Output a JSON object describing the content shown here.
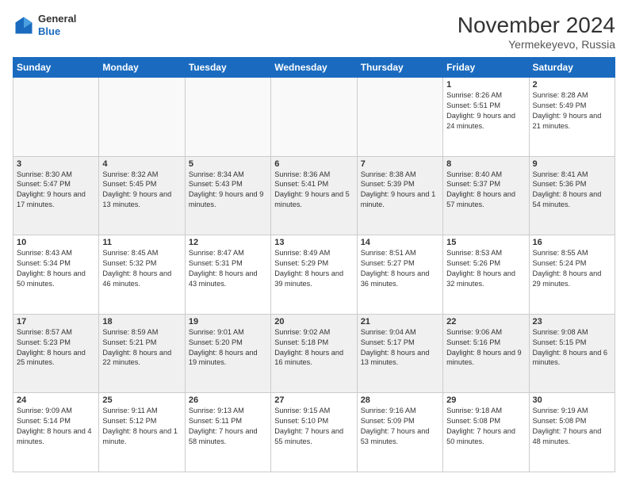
{
  "header": {
    "logo_general": "General",
    "logo_blue": "Blue",
    "month_title": "November 2024",
    "location": "Yermekeyevo, Russia"
  },
  "days_of_week": [
    "Sunday",
    "Monday",
    "Tuesday",
    "Wednesday",
    "Thursday",
    "Friday",
    "Saturday"
  ],
  "weeks": [
    {
      "days": [
        {
          "num": "",
          "sunrise": "",
          "sunset": "",
          "daylight": "",
          "empty": true
        },
        {
          "num": "",
          "sunrise": "",
          "sunset": "",
          "daylight": "",
          "empty": true
        },
        {
          "num": "",
          "sunrise": "",
          "sunset": "",
          "daylight": "",
          "empty": true
        },
        {
          "num": "",
          "sunrise": "",
          "sunset": "",
          "daylight": "",
          "empty": true
        },
        {
          "num": "",
          "sunrise": "",
          "sunset": "",
          "daylight": "",
          "empty": true
        },
        {
          "num": "1",
          "sunrise": "Sunrise: 8:26 AM",
          "sunset": "Sunset: 5:51 PM",
          "daylight": "Daylight: 9 hours and 24 minutes."
        },
        {
          "num": "2",
          "sunrise": "Sunrise: 8:28 AM",
          "sunset": "Sunset: 5:49 PM",
          "daylight": "Daylight: 9 hours and 21 minutes."
        }
      ]
    },
    {
      "days": [
        {
          "num": "3",
          "sunrise": "Sunrise: 8:30 AM",
          "sunset": "Sunset: 5:47 PM",
          "daylight": "Daylight: 9 hours and 17 minutes."
        },
        {
          "num": "4",
          "sunrise": "Sunrise: 8:32 AM",
          "sunset": "Sunset: 5:45 PM",
          "daylight": "Daylight: 9 hours and 13 minutes."
        },
        {
          "num": "5",
          "sunrise": "Sunrise: 8:34 AM",
          "sunset": "Sunset: 5:43 PM",
          "daylight": "Daylight: 9 hours and 9 minutes."
        },
        {
          "num": "6",
          "sunrise": "Sunrise: 8:36 AM",
          "sunset": "Sunset: 5:41 PM",
          "daylight": "Daylight: 9 hours and 5 minutes."
        },
        {
          "num": "7",
          "sunrise": "Sunrise: 8:38 AM",
          "sunset": "Sunset: 5:39 PM",
          "daylight": "Daylight: 9 hours and 1 minute."
        },
        {
          "num": "8",
          "sunrise": "Sunrise: 8:40 AM",
          "sunset": "Sunset: 5:37 PM",
          "daylight": "Daylight: 8 hours and 57 minutes."
        },
        {
          "num": "9",
          "sunrise": "Sunrise: 8:41 AM",
          "sunset": "Sunset: 5:36 PM",
          "daylight": "Daylight: 8 hours and 54 minutes."
        }
      ]
    },
    {
      "days": [
        {
          "num": "10",
          "sunrise": "Sunrise: 8:43 AM",
          "sunset": "Sunset: 5:34 PM",
          "daylight": "Daylight: 8 hours and 50 minutes."
        },
        {
          "num": "11",
          "sunrise": "Sunrise: 8:45 AM",
          "sunset": "Sunset: 5:32 PM",
          "daylight": "Daylight: 8 hours and 46 minutes."
        },
        {
          "num": "12",
          "sunrise": "Sunrise: 8:47 AM",
          "sunset": "Sunset: 5:31 PM",
          "daylight": "Daylight: 8 hours and 43 minutes."
        },
        {
          "num": "13",
          "sunrise": "Sunrise: 8:49 AM",
          "sunset": "Sunset: 5:29 PM",
          "daylight": "Daylight: 8 hours and 39 minutes."
        },
        {
          "num": "14",
          "sunrise": "Sunrise: 8:51 AM",
          "sunset": "Sunset: 5:27 PM",
          "daylight": "Daylight: 8 hours and 36 minutes."
        },
        {
          "num": "15",
          "sunrise": "Sunrise: 8:53 AM",
          "sunset": "Sunset: 5:26 PM",
          "daylight": "Daylight: 8 hours and 32 minutes."
        },
        {
          "num": "16",
          "sunrise": "Sunrise: 8:55 AM",
          "sunset": "Sunset: 5:24 PM",
          "daylight": "Daylight: 8 hours and 29 minutes."
        }
      ]
    },
    {
      "days": [
        {
          "num": "17",
          "sunrise": "Sunrise: 8:57 AM",
          "sunset": "Sunset: 5:23 PM",
          "daylight": "Daylight: 8 hours and 25 minutes."
        },
        {
          "num": "18",
          "sunrise": "Sunrise: 8:59 AM",
          "sunset": "Sunset: 5:21 PM",
          "daylight": "Daylight: 8 hours and 22 minutes."
        },
        {
          "num": "19",
          "sunrise": "Sunrise: 9:01 AM",
          "sunset": "Sunset: 5:20 PM",
          "daylight": "Daylight: 8 hours and 19 minutes."
        },
        {
          "num": "20",
          "sunrise": "Sunrise: 9:02 AM",
          "sunset": "Sunset: 5:18 PM",
          "daylight": "Daylight: 8 hours and 16 minutes."
        },
        {
          "num": "21",
          "sunrise": "Sunrise: 9:04 AM",
          "sunset": "Sunset: 5:17 PM",
          "daylight": "Daylight: 8 hours and 13 minutes."
        },
        {
          "num": "22",
          "sunrise": "Sunrise: 9:06 AM",
          "sunset": "Sunset: 5:16 PM",
          "daylight": "Daylight: 8 hours and 9 minutes."
        },
        {
          "num": "23",
          "sunrise": "Sunrise: 9:08 AM",
          "sunset": "Sunset: 5:15 PM",
          "daylight": "Daylight: 8 hours and 6 minutes."
        }
      ]
    },
    {
      "days": [
        {
          "num": "24",
          "sunrise": "Sunrise: 9:09 AM",
          "sunset": "Sunset: 5:14 PM",
          "daylight": "Daylight: 8 hours and 4 minutes."
        },
        {
          "num": "25",
          "sunrise": "Sunrise: 9:11 AM",
          "sunset": "Sunset: 5:12 PM",
          "daylight": "Daylight: 8 hours and 1 minute."
        },
        {
          "num": "26",
          "sunrise": "Sunrise: 9:13 AM",
          "sunset": "Sunset: 5:11 PM",
          "daylight": "Daylight: 7 hours and 58 minutes."
        },
        {
          "num": "27",
          "sunrise": "Sunrise: 9:15 AM",
          "sunset": "Sunset: 5:10 PM",
          "daylight": "Daylight: 7 hours and 55 minutes."
        },
        {
          "num": "28",
          "sunrise": "Sunrise: 9:16 AM",
          "sunset": "Sunset: 5:09 PM",
          "daylight": "Daylight: 7 hours and 53 minutes."
        },
        {
          "num": "29",
          "sunrise": "Sunrise: 9:18 AM",
          "sunset": "Sunset: 5:08 PM",
          "daylight": "Daylight: 7 hours and 50 minutes."
        },
        {
          "num": "30",
          "sunrise": "Sunrise: 9:19 AM",
          "sunset": "Sunset: 5:08 PM",
          "daylight": "Daylight: 7 hours and 48 minutes."
        }
      ]
    }
  ]
}
